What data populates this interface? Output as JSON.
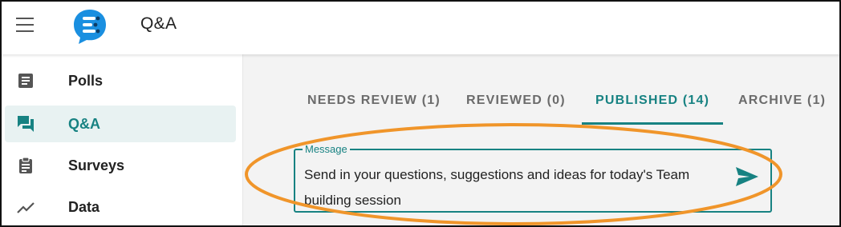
{
  "header": {
    "title": "Q&A",
    "menu_icon": "hamburger-menu-icon",
    "logo_icon": "chat-bubble-logo-icon"
  },
  "sidebar": {
    "items": [
      {
        "label": "Polls",
        "icon": "poll-document-icon",
        "active": false
      },
      {
        "label": "Q&A",
        "icon": "chat-bubbles-icon",
        "active": true
      },
      {
        "label": "Surveys",
        "icon": "clipboard-icon",
        "active": false
      },
      {
        "label": "Data",
        "icon": "trend-line-icon",
        "active": false
      }
    ]
  },
  "tabs": [
    {
      "label": "NEEDS REVIEW (1)",
      "active": false
    },
    {
      "label": "REVIEWED (0)",
      "active": false
    },
    {
      "label": "PUBLISHED (14)",
      "active": true
    },
    {
      "label": "ARCHIVE (1)",
      "active": false
    }
  ],
  "message": {
    "legend": "Message",
    "text": "Send in your questions, suggestions and ideas for today's Team building session",
    "send_icon": "send-arrow-icon"
  },
  "colors": {
    "accent": "#178282",
    "active_bg": "#e8f2f2",
    "highlight": "#f0952a",
    "logo": "#1a8fe0"
  }
}
